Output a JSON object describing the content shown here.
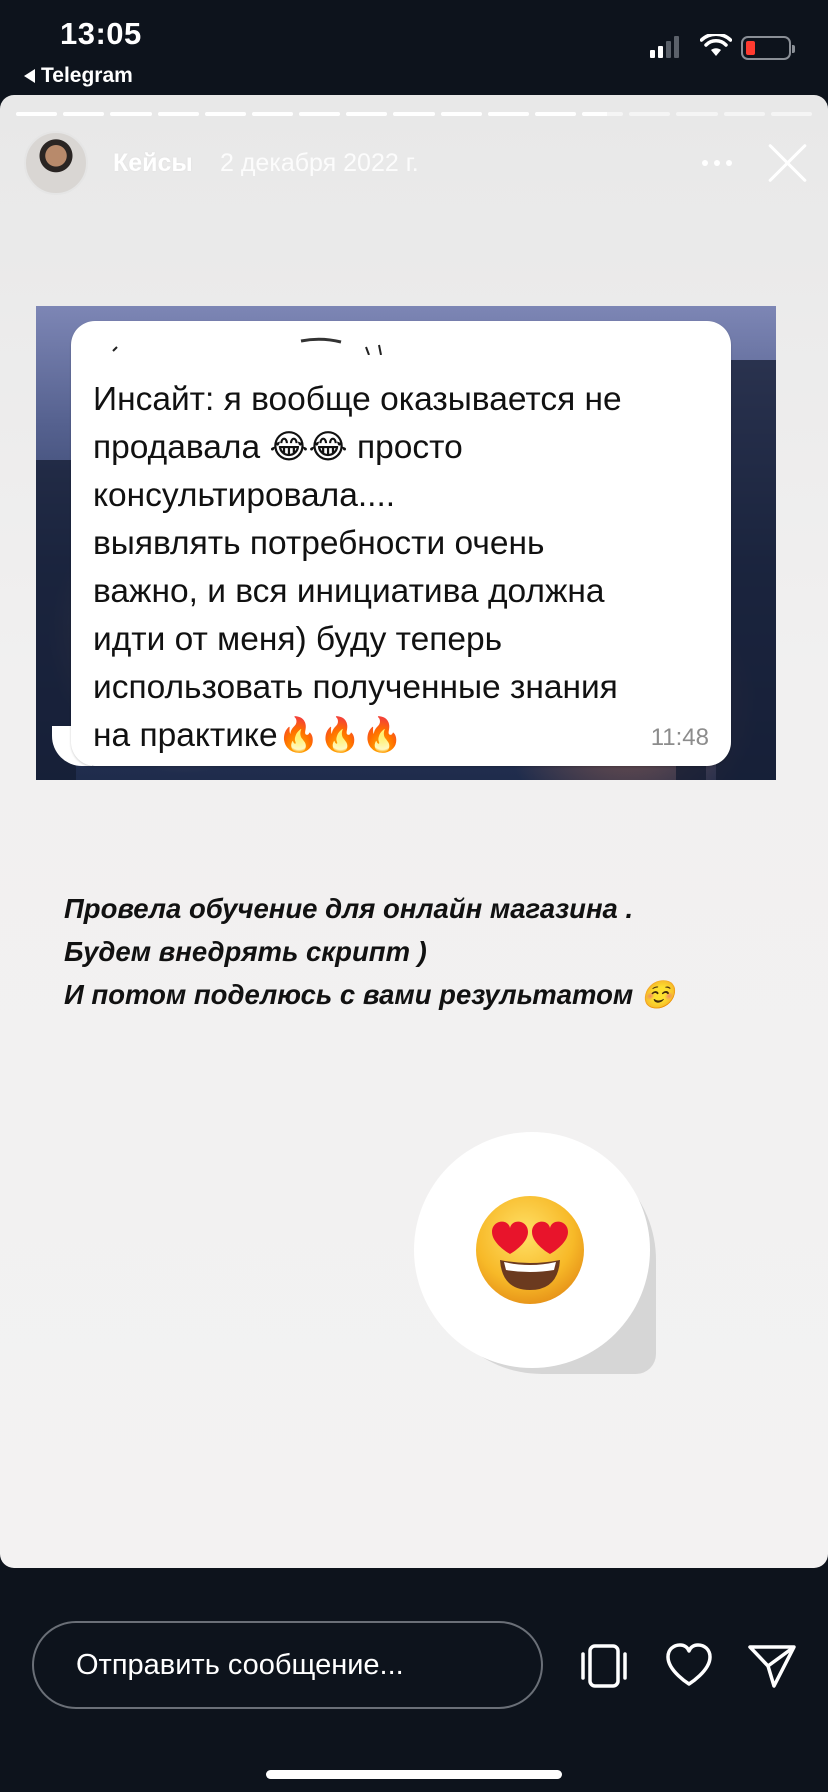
{
  "status_bar": {
    "time": "13:05",
    "back_app": "Telegram",
    "back_icon": "back-arrow-icon",
    "signal_icon": "cellular-signal-icon",
    "wifi_icon": "wifi-icon",
    "battery_icon": "battery-low-icon",
    "battery_color": "#ff3b30"
  },
  "story": {
    "progress_segments": 17,
    "progress_active_index": 12,
    "channel_name": "Кейсы",
    "date": "2 декабря 2022 г.",
    "more_icon": "more-dots-icon",
    "close_icon": "close-icon",
    "avatar_icon": "avatar"
  },
  "screenshot_message": {
    "lines": [
      "Инсайт: я вообще оказывается не",
      "продавала 😂😂 просто",
      "консультировала....",
      "выявлять потребности очень",
      "важно, и вся инициатива должна",
      "идти от меня) буду теперь",
      "использовать полученные знания",
      "на практике🔥🔥🔥"
    ],
    "time": "11:48"
  },
  "caption": {
    "line1": "Провела обучение для онлайн магазина .",
    "line2": "Будем внедрять скрипт )",
    "line3": "И потом поделюсь с вами результатом ☺️"
  },
  "reaction": {
    "icon": "heart-eyes-emoji-icon"
  },
  "reply_bar": {
    "placeholder": "Отправить сообщение...",
    "repost_icon": "repost-icon",
    "like_icon": "heart-icon",
    "share_icon": "send-icon"
  }
}
